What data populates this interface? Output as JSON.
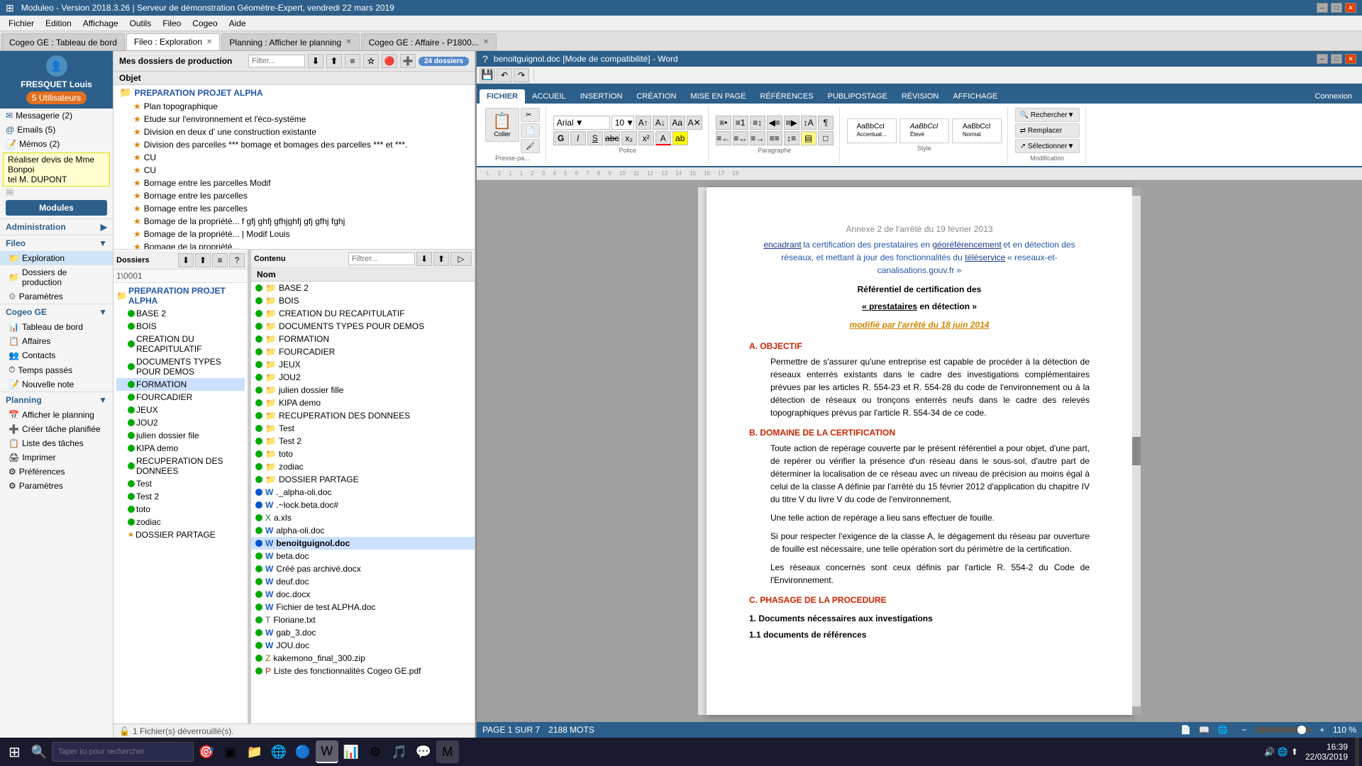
{
  "app": {
    "title": "Moduleo - Version 2018.3.26 | Serveur de démonstration Géomètre-Expert, vendredi 22 mars 2019",
    "min_label": "─",
    "max_label": "□",
    "close_label": "✕"
  },
  "menu": {
    "items": [
      "Fichier",
      "Edition",
      "Affichage",
      "Outils",
      "Fileo",
      "Cogeo",
      "Aide"
    ]
  },
  "tabs": [
    {
      "label": "Cogeo GE : Tableau de bord",
      "active": false,
      "closable": false
    },
    {
      "label": "Fileo : Exploration",
      "active": true,
      "closable": true
    },
    {
      "label": "Planning : Afficher le planning",
      "active": false,
      "closable": true
    },
    {
      "label": "Cogeo GE : Affaire - P1800...",
      "active": false,
      "closable": true
    }
  ],
  "sidebar": {
    "user_name": "FRESQUET Louis",
    "utilisateurs_label": "5 Utilisateurs",
    "messagerie_label": "Messagerie (2)",
    "emails_label": "Emails (5)",
    "memos_label": "Mémos (2)",
    "memo_text1": "Réaliser devis de Mme Bonpoi",
    "memo_text2": "tel M. DUPONT",
    "modules_label": "Modules",
    "administration_label": "Administration",
    "fileo_label": "Fileo",
    "fileo_subitems": [
      "Exploration",
      "Dossiers de production",
      "Paramètres"
    ],
    "cogeo_label": "Cogeo GE",
    "cogeo_subitems": [
      "Tableau de bord",
      "Affaires",
      "Contacts",
      "Temps passés",
      "Nouvelle note"
    ],
    "planning_label": "Planning",
    "planning_subitems": [
      "Afficher le planning",
      "Créer tâche planifiée",
      "Liste des tâches",
      "Imprimer",
      "Préférences",
      "Paramètres"
    ]
  },
  "file_panel": {
    "header": "Mes dossiers de production",
    "filter_placeholder": "Filter...",
    "count_badge": "24 dossiers",
    "column_label": "Objet",
    "items": [
      {
        "type": "folder",
        "name": "PREPARATION PROJET ALPHA",
        "starred": false
      },
      {
        "type": "file",
        "name": "Plan topographique",
        "starred": true
      },
      {
        "type": "file",
        "name": "Etude sur l'environnement et l'éco-système",
        "starred": true
      },
      {
        "type": "file",
        "name": "Division en deux d' une construction existante",
        "starred": true
      },
      {
        "type": "file",
        "name": "Division des parcelles *** bomage et bomages des parcelles *** et ***.",
        "starred": true
      },
      {
        "type": "file",
        "name": "CU",
        "starred": true
      },
      {
        "type": "file",
        "name": "CU",
        "starred": true
      },
      {
        "type": "file",
        "name": "Bornage entre les parcelles Modif",
        "starred": true
      },
      {
        "type": "file",
        "name": "Bornage entre les parcelles",
        "starred": true
      },
      {
        "type": "file",
        "name": "Bornage entre les parcelles",
        "starred": true
      },
      {
        "type": "file",
        "name": "Bomage de la propriété... f gfj ghfj gfhjghfj gfj gfhj fghj",
        "starred": true
      },
      {
        "type": "file",
        "name": "Bomage de la propriété...  | Modif Louis",
        "starred": true
      },
      {
        "type": "file",
        "name": "Bomage de la propriété...",
        "starred": true
      }
    ]
  },
  "folder_tree": {
    "dossiers_label": "Dossiers",
    "contenu_label": "Contenu",
    "filter_placeholder": "Filtrer...",
    "breadcrumb": "1\\0001",
    "root": "PREPARATION PROJET ALPHA",
    "folders": [
      {
        "name": "BASE 2",
        "level": 1,
        "expanded": false
      },
      {
        "name": "BOIS",
        "level": 1,
        "expanded": false
      },
      {
        "name": "CREATION DU RECAPITULATIF",
        "level": 1,
        "expanded": false
      },
      {
        "name": "DOCUMENTS TYPES POUR DEMOS",
        "level": 1,
        "expanded": false
      },
      {
        "name": "FORMATION",
        "level": 1,
        "expanded": false,
        "selected": true
      },
      {
        "name": "FOURCADIER",
        "level": 1,
        "expanded": false
      },
      {
        "name": "JEUX",
        "level": 1,
        "expanded": false
      },
      {
        "name": "JOU2",
        "level": 1,
        "expanded": false
      },
      {
        "name": "julien dossier file",
        "level": 1,
        "expanded": false
      },
      {
        "name": "KIPA demo",
        "level": 1,
        "expanded": false
      },
      {
        "name": "RECUPERATION DES DONNEES",
        "level": 1,
        "expanded": false
      },
      {
        "name": "Test",
        "level": 1,
        "expanded": false
      },
      {
        "name": "Test 2",
        "level": 1,
        "expanded": false
      },
      {
        "name": "toto",
        "level": 1,
        "expanded": false
      },
      {
        "name": "zodiac",
        "level": 1,
        "expanded": false
      },
      {
        "name": "DOSSIER PARTAGE",
        "level": 1,
        "expanded": false,
        "starred": true
      }
    ],
    "content_files": [
      {
        "name": "BASE 2",
        "type": "folder"
      },
      {
        "name": "BOIS",
        "type": "folder"
      },
      {
        "name": "CREATION DU RECAPITULATIF",
        "type": "folder"
      },
      {
        "name": "DOCUMENTS TYPES POUR DEMOS",
        "type": "folder"
      },
      {
        "name": "FORMATION",
        "type": "folder"
      },
      {
        "name": "FOURCADIER",
        "type": "folder"
      },
      {
        "name": "JEUX",
        "type": "folder"
      },
      {
        "name": "JOU2",
        "type": "folder"
      },
      {
        "name": "julien dossier fille",
        "type": "folder"
      },
      {
        "name": "KIPA demo",
        "type": "folder"
      },
      {
        "name": "RECUPERATION DES DONNEES",
        "type": "folder"
      },
      {
        "name": "Test",
        "type": "folder"
      },
      {
        "name": "Test 2",
        "type": "folder"
      },
      {
        "name": "toto",
        "type": "folder"
      },
      {
        "name": "zodiac",
        "type": "folder"
      },
      {
        "name": "DOSSIER PARTAGE",
        "type": "folder"
      },
      {
        "name": "._alpha-oli.doc",
        "type": "word"
      },
      {
        "name": ".~lock.beta.doc#",
        "type": "word"
      },
      {
        "name": "a.xls",
        "type": "excel"
      },
      {
        "name": "alpha-oli.doc",
        "type": "word"
      },
      {
        "name": "benoitguignol.doc",
        "type": "word",
        "selected": true
      },
      {
        "name": "beta.doc",
        "type": "word"
      },
      {
        "name": "Créé pas archivé.docx",
        "type": "word"
      },
      {
        "name": "deuf.doc",
        "type": "word"
      },
      {
        "name": "doc.docx",
        "type": "word"
      },
      {
        "name": "Fichier de test ALPHA.doc",
        "type": "word"
      },
      {
        "name": "Floriane.txt",
        "type": "txt"
      },
      {
        "name": "gab_3.doc",
        "type": "word"
      },
      {
        "name": "JOU.doc",
        "type": "word"
      },
      {
        "name": "kakemono_final_300.zip",
        "type": "zip"
      },
      {
        "name": "Liste des fonctionnalités Cogeo GE.pdf",
        "type": "pdf"
      }
    ]
  },
  "word": {
    "title": "benoitguignol.doc [Mode de compatibilité] - Word",
    "ribbon_tabs": [
      "FICHIER",
      "ACCUEIL",
      "INSERTION",
      "CRÉATION",
      "MISE EN PAGE",
      "RÉFÉRENCES",
      "PUBLIPOSTAGE",
      "RÉVISION",
      "AFFICHAGE"
    ],
    "active_tab": "FICHIER",
    "font": "Arial",
    "font_size": "10",
    "styles": [
      "AaBbCcI Accentuat...",
      "AaBbCcI Élevé",
      "AaBbCcI Normal"
    ],
    "doc": {
      "annex_text": "Annexe 2 de l'arrêté du 19 février 2013",
      "subtitle": "encadrant la certification des prestataires en géoréférencement et en détection des réseaux, et mettant à jour des fonctionnalités du téléservice « reseaux-et-canalisations.gouv.fr »",
      "title": "Référentiel de certification des",
      "title2": "« prestataires en détection »",
      "modified_text": "modifié par l'arrêté du 18 juin 2014",
      "section_a": "A.  OBJECTIF",
      "para_a": "Permettre de s'assurer qu'une entreprise est capable de procéder à la détection de réseaux enterrés existants dans le cadre des investigations complémentaires prévues par les articles R. 554-23 et R. 554-28 du code de l'environnement ou à la détection de réseaux ou tronçons enterrés neufs dans le cadre des relevés topographiques prévus par l'article R. 554-34 de ce code.",
      "section_b": "B.  DOMAINE DE LA CERTIFICATION",
      "para_b": "Toute action de repérage couverte par le présent référentiel a pour objet, d'une part, de repérer ou vérifier la présence d'un réseau dans le sous-sol, d'autre part de déterminer la localisation de ce réseau avec un niveau de précision au moins égal à celui de la classe A définie par l'arrêté du 15 février 2012 d'application du chapitre IV du titre V du livre V du code de l'environnement.",
      "para_b2": "Une telle action de repérage a lieu sans effectuer de fouille.",
      "para_b3": "Si pour respecter l'exigence de la classe A, le dégagement du réseau par ouverture de fouille est nécessaire, une telle opération sort du périmètre de la certification.",
      "para_b4": "Les réseaux concernés sont ceux définis par l'article R. 554-2 du Code de l'Environnement.",
      "section_c": "C.  PHASAGE DE LA PROCEDURE",
      "sub1": "1.  Documents nécessaires aux investigations",
      "sub1_1": "1.1 documents de références"
    },
    "status": {
      "page": "PAGE 1 SUR 7",
      "words": "2188 MOTS",
      "zoom": "110 %"
    },
    "connexion_label": "Connexion"
  },
  "taskbar": {
    "search_placeholder": "Taper ici pour rechercher",
    "time": "16:39",
    "date": "22/03/2019",
    "notification_text": "1 Fichier(s) déverrouillé(s)."
  }
}
